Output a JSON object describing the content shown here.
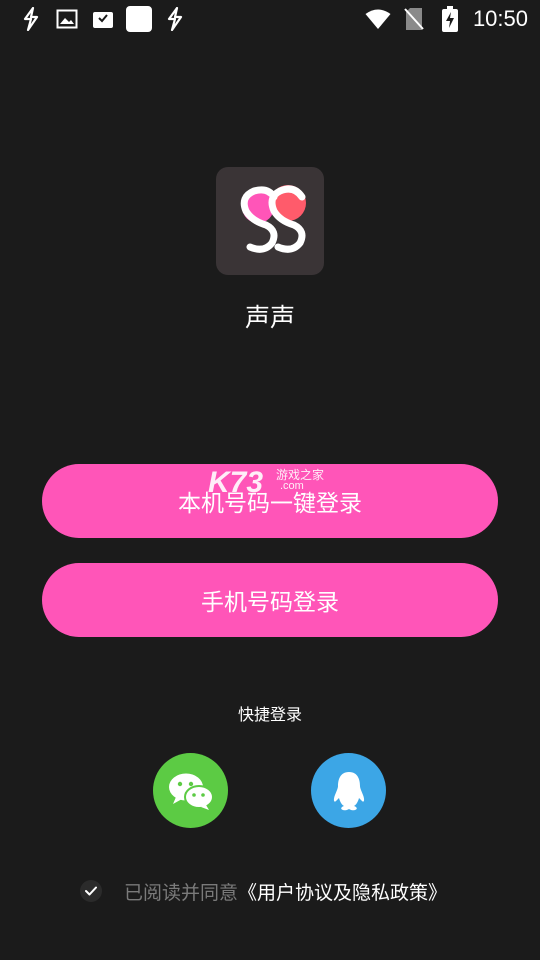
{
  "status_bar": {
    "time": "10:50",
    "left_icons": [
      "bolt-icon",
      "image-icon",
      "calendar-icon",
      "square-icon",
      "bolt-icon"
    ],
    "right_icons": [
      "wifi-icon",
      "no-sim-icon",
      "battery-charging-icon"
    ]
  },
  "app": {
    "name": "声声",
    "logo": "ss-logo"
  },
  "buttons": {
    "one_click": "本机号码一键登录",
    "phone": "手机号码登录"
  },
  "watermark": {
    "logo": "K73",
    "text": "游戏之家",
    "domain": ".com"
  },
  "quick_login": {
    "title": "快捷登录",
    "options": [
      "wechat-icon",
      "qq-icon"
    ]
  },
  "agreement": {
    "prefix": "已阅读并同意",
    "link": "《用户协议及隐私政策》"
  },
  "colors": {
    "background": "#1b1b1b",
    "accent": "#ff55b8",
    "wechat": "#5ccb44",
    "qq": "#3ca6e6"
  }
}
